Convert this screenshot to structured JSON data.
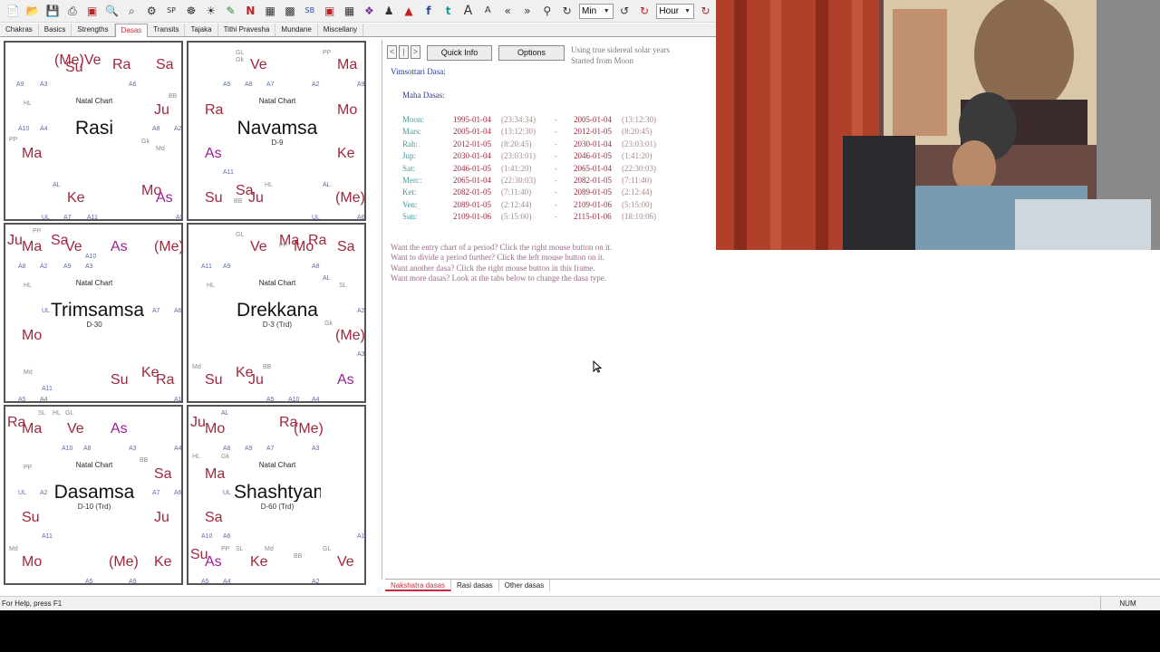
{
  "toolbar": {
    "icons": [
      "new-file-icon",
      "open-folder-icon",
      "save-icon",
      "print-icon",
      "chart-icon",
      "search-data-icon",
      "zoom-icon",
      "settings-icon",
      "sp-kh-icon",
      "wheel-icon",
      "sun-icon",
      "pencil-icon",
      "n-icon",
      "grid-icon",
      "table-icon",
      "sb-icon",
      "square-icon",
      "calendar-icon",
      "book-icon",
      "people-icon",
      "fire-icon",
      "facebook-icon",
      "twitter-icon",
      "font-large-icon",
      "font-small-icon",
      "prev-icon",
      "next-icon",
      "bulb-icon"
    ],
    "unit_select": "Min",
    "step_select": "Hour"
  },
  "tabs": [
    "Chakras",
    "Basics",
    "Strengths",
    "Dasas",
    "Transits",
    "Tajaka",
    "Tithi Pravesha",
    "Mundane",
    "Miscellany"
  ],
  "active_tab": "Dasas",
  "charts": [
    {
      "natal": "Natal Chart",
      "name": "Rasi",
      "sub": ""
    },
    {
      "natal": "Natal Chart",
      "name": "Navamsa",
      "sub": "D-9"
    },
    {
      "natal": "Natal Chart",
      "name": "Trimsamsa",
      "sub": "D-30"
    },
    {
      "natal": "Natal Chart",
      "name": "Drekkana",
      "sub": "D-3 (Trd)"
    },
    {
      "natal": "Natal Chart",
      "name": "Dasamsa",
      "sub": "D-10 (Trd)"
    },
    {
      "natal": "Natal Chart",
      "name": "Shashtyamsa",
      "sub": "D-60 (Trd)"
    }
  ],
  "dasa": {
    "buttons": {
      "prev": "<",
      "pause": "|",
      "next": ">",
      "quick_info": "Quick Info",
      "options": "Options"
    },
    "info1": "Using true sidereal solar years",
    "info2": "Started from Moon",
    "title": "Vimsottari Dasa:",
    "subtitle": "Maha Dasas:",
    "rows": [
      {
        "lord": "Moon:",
        "start": "1995-01-04",
        "st": "(23:34:34)",
        "dash": "-",
        "end": "2005-01-04",
        "et": "(13:12:30)"
      },
      {
        "lord": "Mars:",
        "start": "2005-01-04",
        "st": "(13:12:30)",
        "dash": "-",
        "end": "2012-01-05",
        "et": "(8:20:45)"
      },
      {
        "lord": "Rah:",
        "start": "2012-01-05",
        "st": "(8:20:45)",
        "dash": "-",
        "end": "2030-01-04",
        "et": "(23:03:01)"
      },
      {
        "lord": "Jup:",
        "start": "2030-01-04",
        "st": "(23:03:01)",
        "dash": "-",
        "end": "2046-01-05",
        "et": "(1:41:20)"
      },
      {
        "lord": "Sat:",
        "start": "2046-01-05",
        "st": "(1:41:20)",
        "dash": "-",
        "end": "2065-01-04",
        "et": "(22:30:03)"
      },
      {
        "lord": "Merc:",
        "start": "2065-01-04",
        "st": "(22:30:03)",
        "dash": "-",
        "end": "2082-01-05",
        "et": "(7:11:40)"
      },
      {
        "lord": "Ket:",
        "start": "2082-01-05",
        "st": "(7:11:40)",
        "dash": "-",
        "end": "2089-01-05",
        "et": "(2:12:44)"
      },
      {
        "lord": "Ven:",
        "start": "2089-01-05",
        "st": "(2:12:44)",
        "dash": "-",
        "end": "2109-01-06",
        "et": "(5:15:00)"
      },
      {
        "lord": "Sun:",
        "start": "2109-01-06",
        "st": "(5:15:00)",
        "dash": "-",
        "end": "2115-01-06",
        "et": "(18:10:06)"
      }
    ],
    "help": [
      "Want the entry chart of a period? Click the right mouse button on it.",
      "Want to divide a period further? Click the left mouse button on it.",
      "Want another dasa? Click the right mouse button in this frame.",
      "Want more dasas? Look at the tabs below to change the dasa type."
    ]
  },
  "bottom_tabs": [
    "Nakshatra dasas",
    "Rasi dasas",
    "Other dasas"
  ],
  "status": {
    "left": "For Help, press F1",
    "right": "NUM"
  },
  "colors": {
    "planet": "#a0283c",
    "planet_alt": "#9a1f9a",
    "accent": "#c0303a"
  }
}
